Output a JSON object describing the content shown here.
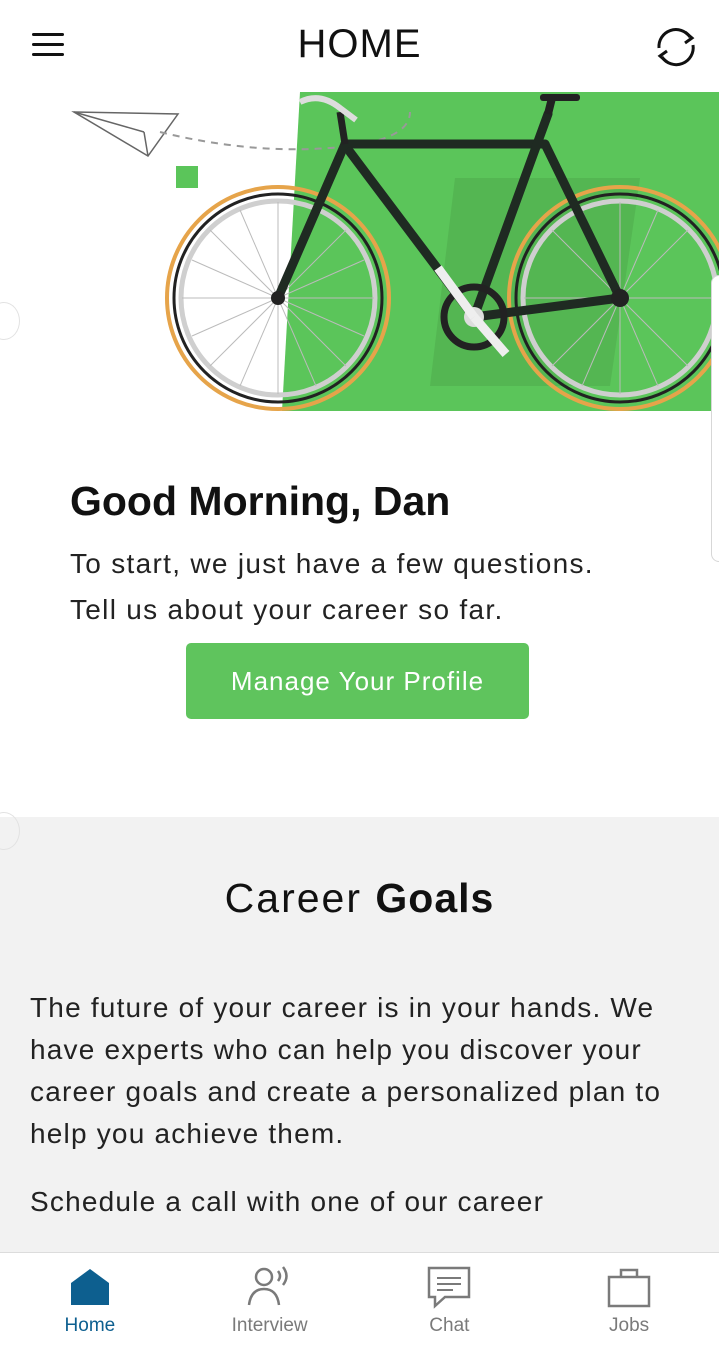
{
  "header": {
    "title": "HOME",
    "menu_icon": "hamburger-menu-icon",
    "refresh_icon": "refresh-icon"
  },
  "hero": {
    "image": "bicycle-illustration",
    "accent_color": "#5bc55a"
  },
  "greeting": {
    "title": "Good Morning, Dan",
    "line1": "To start, we just have a few questions.",
    "line2": "Tell us about your career so far.",
    "button_label": "Manage Your Profile"
  },
  "career_goals": {
    "title_light": "Career",
    "title_bold": "Goals",
    "paragraph1": "The future of your career is in your hands. We have experts who can help you discover your career goals and create a personalized plan to help you achieve them.",
    "paragraph2": "Schedule a call with one of our career"
  },
  "tabbar": {
    "tabs": [
      {
        "label": "Home",
        "icon": "home-icon",
        "active": true
      },
      {
        "label": "Interview",
        "icon": "interview-icon",
        "active": false
      },
      {
        "label": "Chat",
        "icon": "chat-icon",
        "active": false
      },
      {
        "label": "Jobs",
        "icon": "briefcase-icon",
        "active": false
      }
    ]
  },
  "colors": {
    "brand_green": "#5fc45d",
    "active_tab": "#0d5f8f",
    "inactive_tab": "#7a7a7a",
    "section_bg": "#f2f2f2"
  }
}
